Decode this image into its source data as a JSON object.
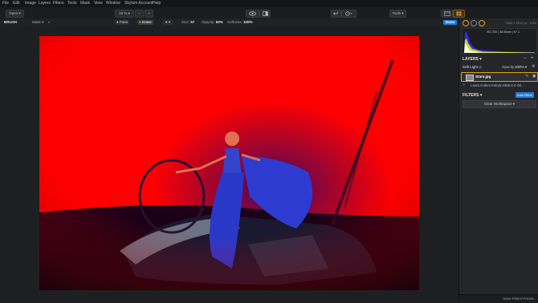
{
  "menu": [
    "File",
    "Edit",
    "Image",
    "Layers",
    "Filters",
    "Tools",
    "Mask",
    "View",
    "Window",
    "Skylum Account",
    "Help"
  ],
  "toolbar": {
    "open_label": "Open ▾",
    "zoom_label": "15 % ▾",
    "zoom_out": "−",
    "zoom_in": "+",
    "tools_label": "Tools ▾"
  },
  "options": {
    "tool_name": "BRUSH",
    "mask_label": "Mask ▾",
    "paint_label": "Paint",
    "erase_label": "Erase",
    "brush_preset": "▾",
    "size_label": "Size:",
    "size_value": "57",
    "opacity_label": "Opacity:",
    "opacity_value": "50%",
    "softness_label": "Softness:",
    "softness_value": "100%",
    "done_label": "Done"
  },
  "image_info": "7360 × 4912 px · 6.84",
  "histogram": {
    "readout": "ISO 200 | 38.00mm | f/7.1",
    "colors": {
      "blue": "#2a2bff",
      "yellow": "#e6e600",
      "white": "#ffffff"
    }
  },
  "layers": {
    "title": "LAYERS ▾",
    "blend_mode": "Soft Light ◇",
    "opacity_label": "Opacity:",
    "opacity_value": "100% ▾",
    "items": [
      {
        "name": "Stars.jpg",
        "selected": true
      },
      {
        "name": "Laura Anders Kotryb-2369-3-2-Orl...",
        "selected": false
      }
    ]
  },
  "filters": {
    "title": "FILTERS ▾",
    "add_button": "Add Filters",
    "clear_button": "Clear Workspace ▾"
  },
  "save_preset": "Save Filters Preset...",
  "accent": "#1f7fe0",
  "highlight": "#e0a020"
}
